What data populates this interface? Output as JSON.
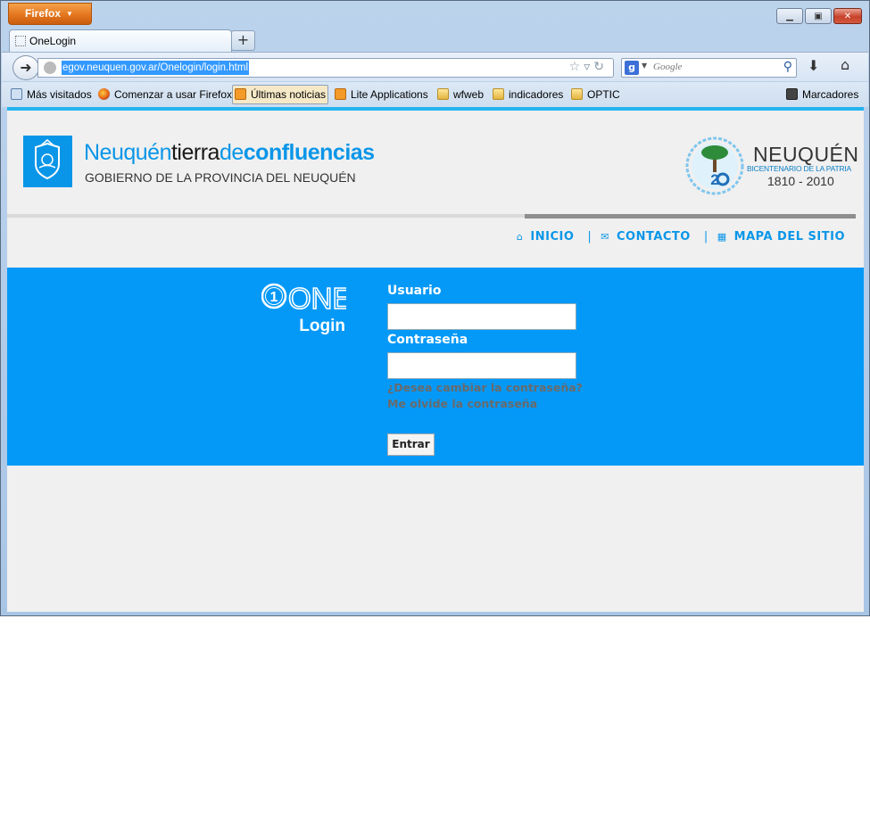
{
  "browser": {
    "menu_label": "Firefox",
    "tab_title": "OneLogin",
    "new_tab_label": "+",
    "url": "egov.neuquen.gov.ar/Onelogin/login.html",
    "search_placeholder": "Google",
    "search_engine_letter": "g",
    "bookmarks": [
      {
        "label": "Más visitados",
        "icon": "most-visited-icon"
      },
      {
        "label": "Comenzar a usar Firefox",
        "icon": "firefox-icon"
      },
      {
        "label": "Últimas noticias",
        "icon": "rss-icon"
      },
      {
        "label": "Lite Applications",
        "icon": "rss-icon"
      },
      {
        "label": "wfweb",
        "icon": "folder-icon"
      },
      {
        "label": "indicadores",
        "icon": "folder-icon"
      },
      {
        "label": "OPTIC",
        "icon": "folder-icon"
      }
    ],
    "bookmarks_menu_label": "Marcadores"
  },
  "header": {
    "brand_a": "Neuquén",
    "brand_b": "tierra",
    "brand_c": "de",
    "brand_d": "confluencias",
    "subtitle": "GOBIERNO DE LA PROVINCIA DEL NEUQUÉN",
    "bicentenario_title": "NEUQUÉN",
    "bicentenario_sub": "BICENTENARIO DE LA PATRIA",
    "bicentenario_years": "1810 - 2010"
  },
  "topnav": [
    {
      "label": "INICIO",
      "icon": "home-icon"
    },
    {
      "label": "CONTACTO",
      "icon": "mail-icon"
    },
    {
      "label": "MAPA DEL SITIO",
      "icon": "sitemap-icon"
    }
  ],
  "login": {
    "logo_one": "ONE",
    "logo_login": "Login",
    "usuario_label": "Usuario",
    "usuario_value": "",
    "password_label": "Contraseña",
    "password_value": "",
    "change_password_link": "¿Desea cambiar la contraseña?",
    "forgot_password_link": "Me olvide la contraseña",
    "submit_label": "Entrar"
  },
  "colors": {
    "accent_blue": "#0599f7",
    "brand_blue": "#0a96e8",
    "page_bg": "#f0f0f0",
    "firefox_orange": "#e2731c"
  }
}
